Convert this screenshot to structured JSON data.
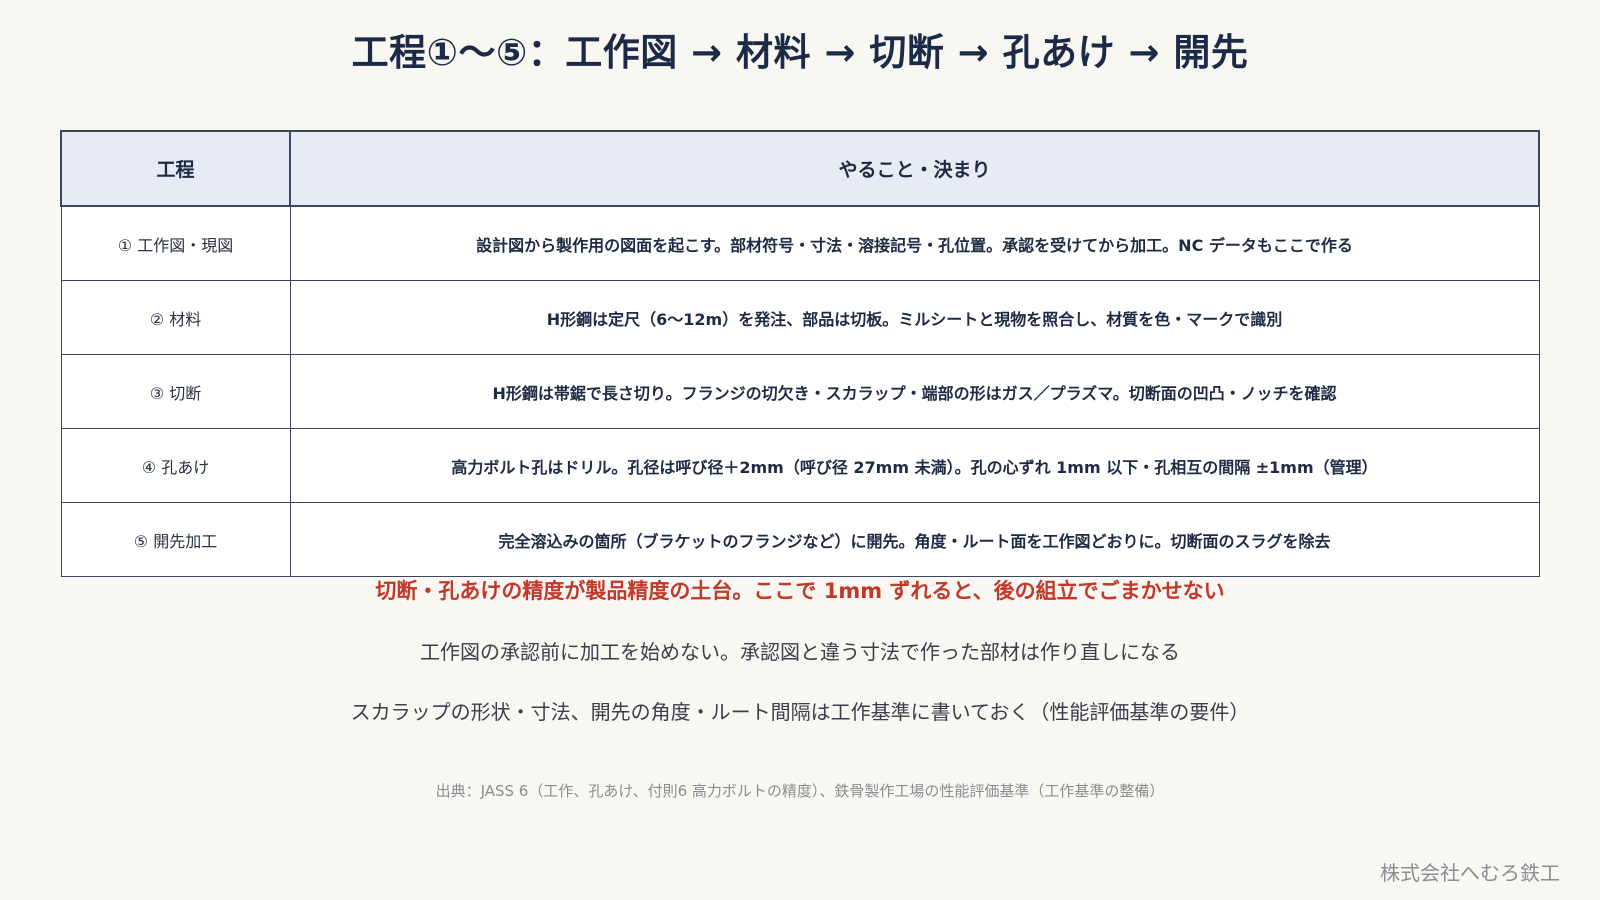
{
  "title": "工程①～⑤：工作図 → 材料 → 切断 → 孔あけ → 開先",
  "table": {
    "headers": [
      "工程",
      "やること・決まり"
    ],
    "rows": [
      {
        "step": "① 工作図・現図",
        "rule": "設計図から製作用の図面を起こす。部材符号・寸法・溶接記号・孔位置。承認を受けてから加工。NC データもここで作る"
      },
      {
        "step": "② 材料",
        "rule": "H形鋼は定尺（6～12m）を発注、部品は切板。ミルシートと現物を照合し、材質を色・マークで識別"
      },
      {
        "step": "③ 切断",
        "rule": "H形鋼は帯鋸で長さ切り。フランジの切欠き・スカラップ・端部の形はガス／プラズマ。切断面の凹凸・ノッチを確認"
      },
      {
        "step": "④ 孔あけ",
        "rule": "高力ボルト孔はドリル。孔径は呼び径＋2mm（呼び径 27mm 未満）。孔の心ずれ 1mm 以下・孔相互の間隔 ±1mm（管理）"
      },
      {
        "step": "⑤ 開先加工",
        "rule": "完全溶込みの箇所（ブラケットのフランジなど）に開先。角度・ルート面を工作図どおりに。切断面のスラグを除去"
      }
    ]
  },
  "highlight": "切断・孔あけの精度が製品精度の土台。ここで 1mm ずれると、後の組立でごまかせない",
  "notes": [
    "工作図の承認前に加工を始めない。承認図と違う寸法で作った部材は作り直しになる",
    "スカラップの形状・寸法、開先の角度・ルート間隔は工作基準に書いておく（性能評価基準の要件）"
  ],
  "source": "出典：JASS 6（工作、孔あけ、付則6 高力ボルトの精度）、鉄骨製作工場の性能評価基準（工作基準の整備）",
  "company": "株式会社へむろ鉄工",
  "colors": {
    "background": "#f8f7f2",
    "header_bg": "#e7ebf4",
    "title": "#1c2a48",
    "highlight": "#c0392b",
    "muted": "#8a8d93"
  }
}
